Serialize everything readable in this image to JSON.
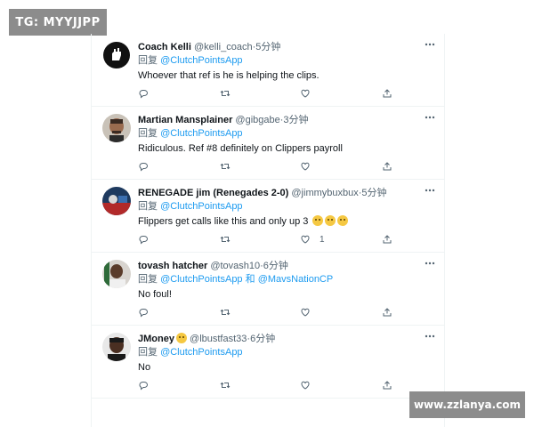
{
  "watermarks": {
    "top": "TG: MYYJJPP",
    "bottom": "www.zzlanya.com"
  },
  "colors": {
    "mention": "#1d9bf0",
    "meta": "#536471",
    "divider": "#eff3f4"
  },
  "icons": {
    "more": "more-icon",
    "reply": "reply-icon",
    "retweet": "retweet-icon",
    "like": "heart-icon",
    "share": "share-icon"
  },
  "tweets": [
    {
      "name": "Coach Kelli",
      "handle": "@kelli_coach",
      "sep": "·",
      "time": "5分钟",
      "reply_prefix": "回复",
      "mention1": "@ClutchPointsApp",
      "mention_join": "",
      "mention2": "",
      "text": "Whoever that ref is he is helping the clips.",
      "like_count": ""
    },
    {
      "name": "Martian Mansplainer",
      "handle": "@gibgabe",
      "sep": "·",
      "time": "3分钟",
      "reply_prefix": "回复",
      "mention1": "@ClutchPointsApp",
      "mention_join": "",
      "mention2": "",
      "text": "Ridiculous. Ref #8 definitely on Clippers payroll",
      "like_count": ""
    },
    {
      "name": "RENEGADE jim (Renegades 2-0)",
      "handle": "@jimmybuxbux",
      "sep": "·",
      "time": "5分钟",
      "reply_prefix": "回复",
      "mention1": "@ClutchPointsApp",
      "mention_join": "",
      "mention2": "",
      "text": "Flippers get calls like this and only up 3",
      "like_count": "1"
    },
    {
      "name": "tovash hatcher",
      "handle": "@tovash10",
      "sep": "·",
      "time": "6分钟",
      "reply_prefix": "回复",
      "mention1": "@ClutchPointsApp",
      "mention_join": "和",
      "mention2": "@MavsNationCP",
      "text": "No foul!",
      "like_count": ""
    },
    {
      "name": "JMoney",
      "handle": "@lbustfast33",
      "sep": "·",
      "time": "6分钟",
      "reply_prefix": "回复",
      "mention1": "@ClutchPointsApp",
      "mention_join": "",
      "mention2": "",
      "text": "No",
      "like_count": ""
    }
  ]
}
